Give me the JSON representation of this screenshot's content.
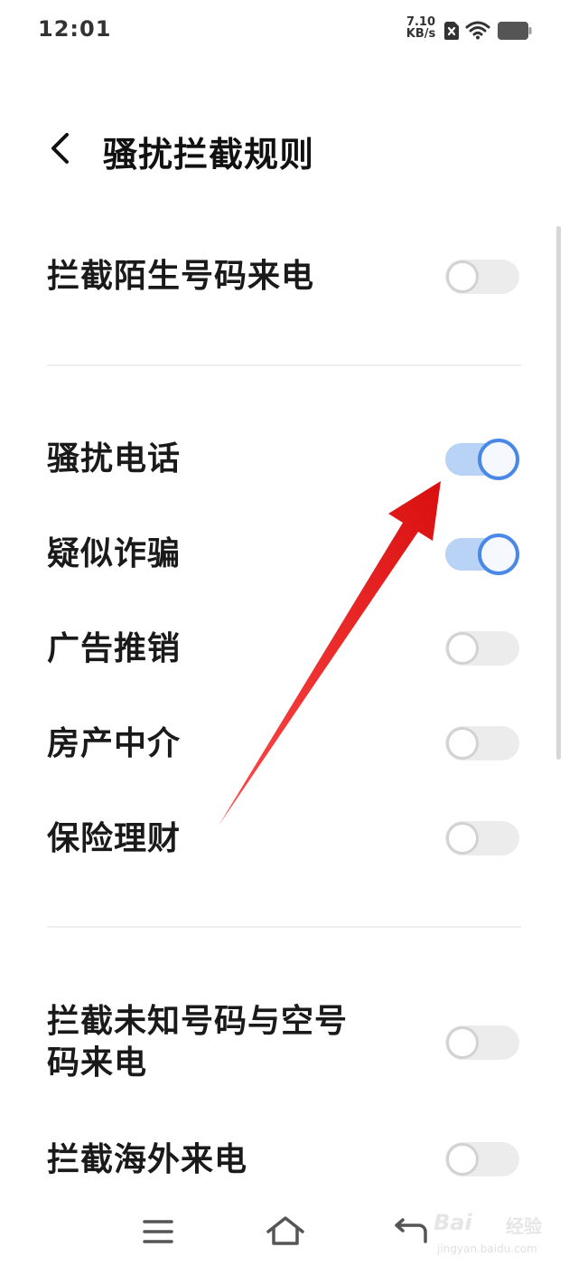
{
  "status_bar": {
    "time": "12:01",
    "net_speed_value": "7.10",
    "net_speed_unit": "KB/s",
    "icons": [
      "no-sim-icon",
      "wifi-icon",
      "battery-icon"
    ]
  },
  "header": {
    "title": "骚扰拦截规则",
    "back_icon": "chevron-left-icon"
  },
  "settings": [
    {
      "label": "拦截陌生号码来电",
      "enabled": false
    },
    {
      "label": "骚扰电话",
      "enabled": true
    },
    {
      "label": "疑似诈骗",
      "enabled": true
    },
    {
      "label": "广告推销",
      "enabled": false
    },
    {
      "label": "房产中介",
      "enabled": false
    },
    {
      "label": "保险理财",
      "enabled": false
    },
    {
      "label": "拦截未知号码与空号码来电",
      "label_line1": "拦截未知号码与空号",
      "label_line2": "码来电",
      "enabled": false
    },
    {
      "label": "拦截海外来电",
      "enabled": false
    }
  ],
  "nav_bar": {
    "icons": [
      "menu-icon",
      "home-icon",
      "back-icon"
    ]
  },
  "annotation": {
    "type": "red-arrow",
    "points_to": "骚扰电话 toggle",
    "color": "#e81818"
  },
  "watermark": {
    "logo": "Bai",
    "brand": "经验",
    "url": "jingyan.baidu.com"
  },
  "colors": {
    "toggle_on_track": "#b9d3f7",
    "toggle_on_knob_border": "#4a88e6",
    "toggle_off_track": "#ececec",
    "toggle_off_knob_border": "#d2d2d2"
  }
}
